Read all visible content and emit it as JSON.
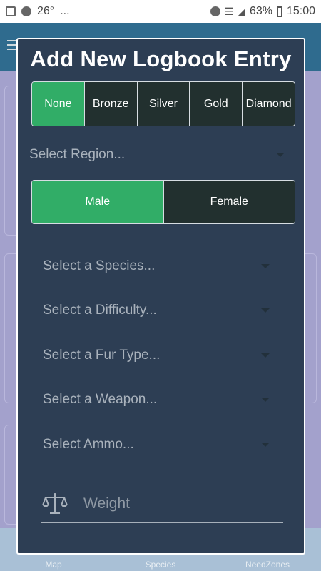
{
  "status_bar": {
    "temperature": "26°",
    "more": "...",
    "battery": "63%",
    "time": "15:00"
  },
  "background_tabs": [
    {
      "label": "Map"
    },
    {
      "label": "Species"
    },
    {
      "label": "NeedZones"
    }
  ],
  "modal": {
    "title": "Add New Logbook Entry",
    "medals": [
      {
        "label": "None",
        "selected": true
      },
      {
        "label": "Bronze",
        "selected": false
      },
      {
        "label": "Silver",
        "selected": false
      },
      {
        "label": "Gold",
        "selected": false
      },
      {
        "label": "Diamond",
        "selected": false
      }
    ],
    "region_placeholder": "Select Region...",
    "gender": [
      {
        "label": "Male",
        "selected": true
      },
      {
        "label": "Female",
        "selected": false
      }
    ],
    "dropdowns": [
      {
        "label": "Select a Species..."
      },
      {
        "label": "Select a Difficulty..."
      },
      {
        "label": "Select a Fur Type..."
      },
      {
        "label": "Select a Weapon..."
      },
      {
        "label": "Select Ammo..."
      }
    ],
    "weight_placeholder": "Weight"
  },
  "colors": {
    "modal_bg": "#2d3e54",
    "active_green": "#31ad67",
    "segment_dark": "#22302f",
    "placeholder_gray": "#a9b2bc"
  }
}
